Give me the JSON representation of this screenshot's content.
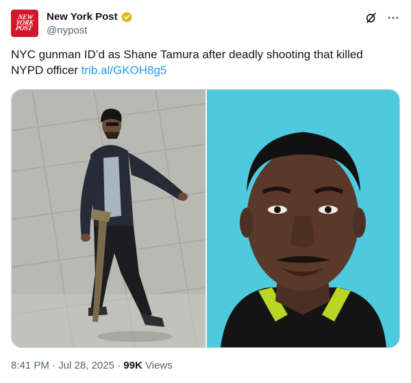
{
  "account": {
    "display_name": "New York Post",
    "handle": "@nypost",
    "logo_text": "NEW\nYORK\nPOST",
    "verified": true
  },
  "tweet": {
    "text": "NYC gunman ID’d as Shane Tamura after deadly shooting that killed NYPD officer ",
    "link": "trib.al/GKOH8g5"
  },
  "media": [
    {
      "description_icon": "surveillance-photo"
    },
    {
      "description_icon": "id-portrait-photo"
    }
  ],
  "meta": {
    "time": "8:41 PM",
    "separator": "·",
    "date": "Jul 28, 2025",
    "views_count": "99K",
    "views_label": "Views"
  },
  "colors": {
    "brand": "#d3172a",
    "link": "#1d9bf0",
    "verified_gold": "#e2b719",
    "muted": "#536471",
    "portrait_bg": "#4ec9dd"
  },
  "icons": {
    "grok": "grok-icon",
    "more": "more-icon",
    "verified": "verified-badge-icon"
  }
}
